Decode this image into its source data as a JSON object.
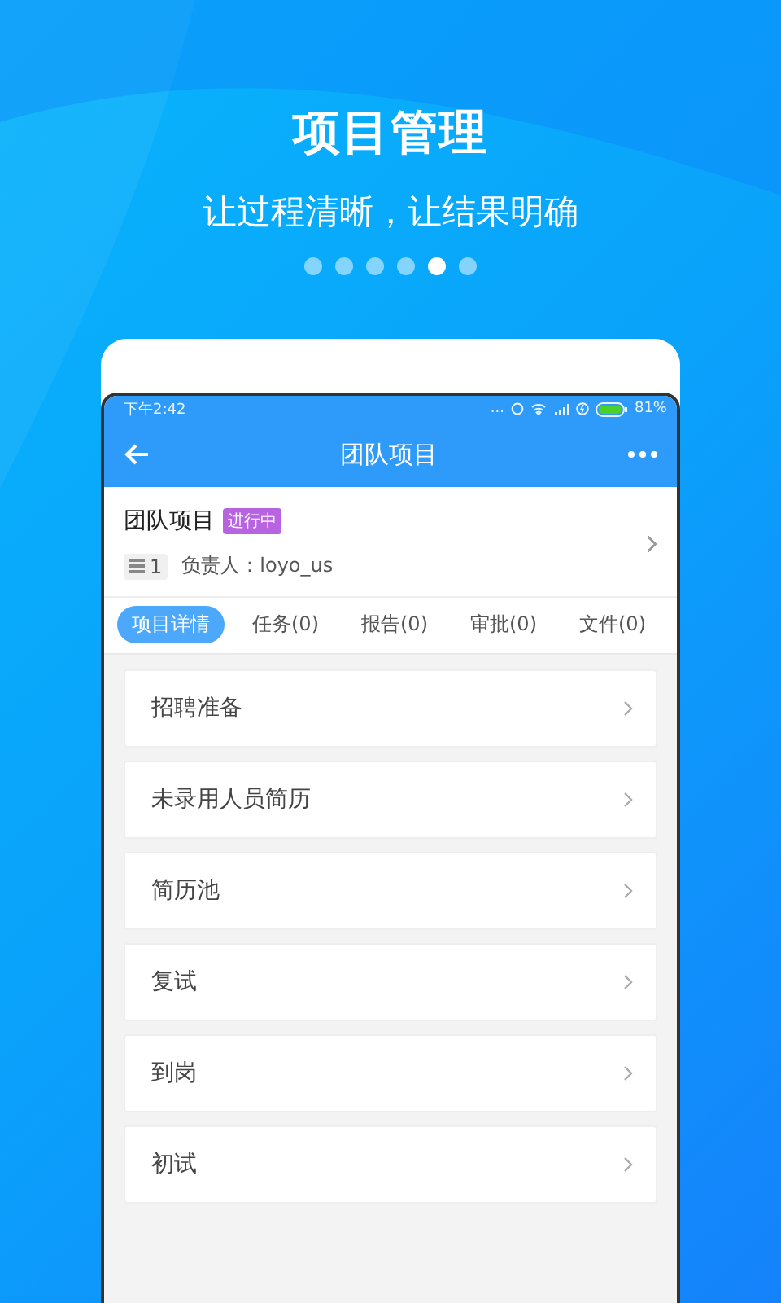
{
  "headline": {
    "title": "项目管理",
    "subtitle": "让过程清晰，让结果明确"
  },
  "pager_dots": [
    {
      "selected": false
    },
    {
      "selected": false
    },
    {
      "selected": false
    },
    {
      "selected": false
    },
    {
      "selected": true
    },
    {
      "selected": false
    }
  ],
  "status_bar": {
    "time": "下午2:42",
    "overflow": "...",
    "battery_percent": "81%"
  },
  "app_bar": {
    "title": "团队项目"
  },
  "project": {
    "name": "团队项目",
    "status": "进行中",
    "count": "1",
    "owner": "负责人：loyo_us"
  },
  "tabs": [
    {
      "label": "项目详情",
      "selected": true
    },
    {
      "label": "任务(0)",
      "selected": false
    },
    {
      "label": "报告(0)",
      "selected": false
    },
    {
      "label": "审批(0)",
      "selected": false
    },
    {
      "label": "文件(0)",
      "selected": false
    }
  ],
  "stages": [
    {
      "label": "招聘准备"
    },
    {
      "label": "未录用人员简历"
    },
    {
      "label": "简历池"
    },
    {
      "label": "复试"
    },
    {
      "label": "到岗"
    },
    {
      "label": "初试"
    }
  ]
}
